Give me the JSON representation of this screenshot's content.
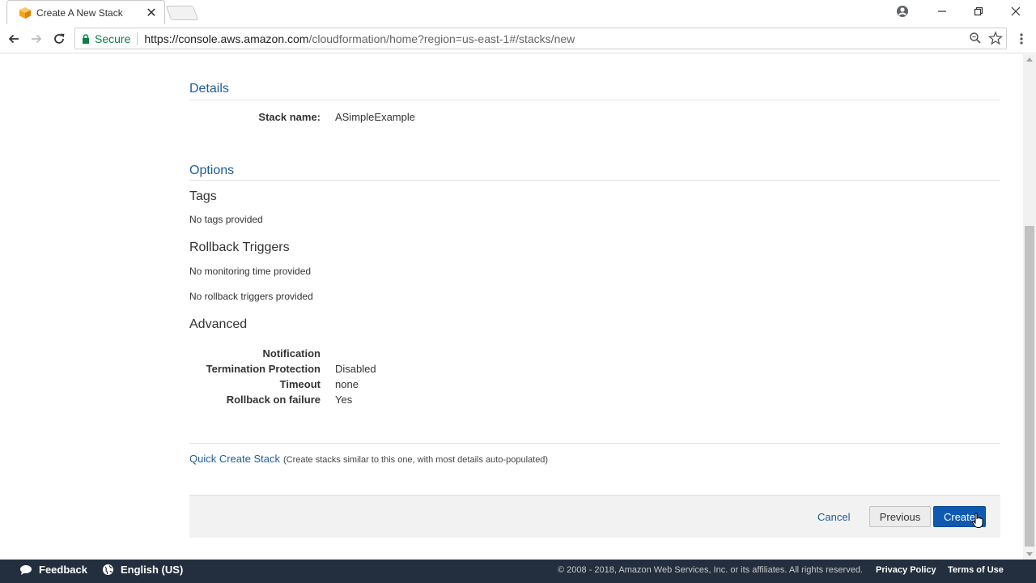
{
  "browser": {
    "tab_title": "Create A New Stack",
    "secure_label": "Secure",
    "url_scheme_host": "https://console.aws.amazon.com",
    "url_path": "/cloudformation/home?region=us-east-1#/stacks/new"
  },
  "details": {
    "section_title": "Details",
    "stack_name_label": "Stack name:",
    "stack_name_value": "ASimpleExample"
  },
  "options": {
    "section_title": "Options",
    "tags_title": "Tags",
    "tags_text": "No tags provided",
    "rollback_title": "Rollback Triggers",
    "monitoring_text": "No monitoring time provided",
    "triggers_text": "No rollback triggers provided",
    "advanced_title": "Advanced",
    "advanced_rows": [
      {
        "label": "Notification",
        "value": ""
      },
      {
        "label": "Termination Protection",
        "value": "Disabled"
      },
      {
        "label": "Timeout",
        "value": "none"
      },
      {
        "label": "Rollback on failure",
        "value": "Yes"
      }
    ]
  },
  "quick_create": {
    "link_label": "Quick Create Stack",
    "note": "(Create stacks similar to this one, with most details auto-populated)"
  },
  "actions": {
    "cancel_label": "Cancel",
    "previous_label": "Previous",
    "create_label": "Create"
  },
  "footer": {
    "feedback_label": "Feedback",
    "language_label": "English (US)",
    "copyright": "© 2008 - 2018, Amazon Web Services, Inc. or its affiliates. All rights reserved.",
    "privacy_label": "Privacy Policy",
    "terms_label": "Terms of Use"
  },
  "colors": {
    "link_blue": "#1f5c99",
    "primary_button": "#0f5ab0",
    "footer_bg": "#232f3e",
    "secure_green": "#0b8043"
  }
}
